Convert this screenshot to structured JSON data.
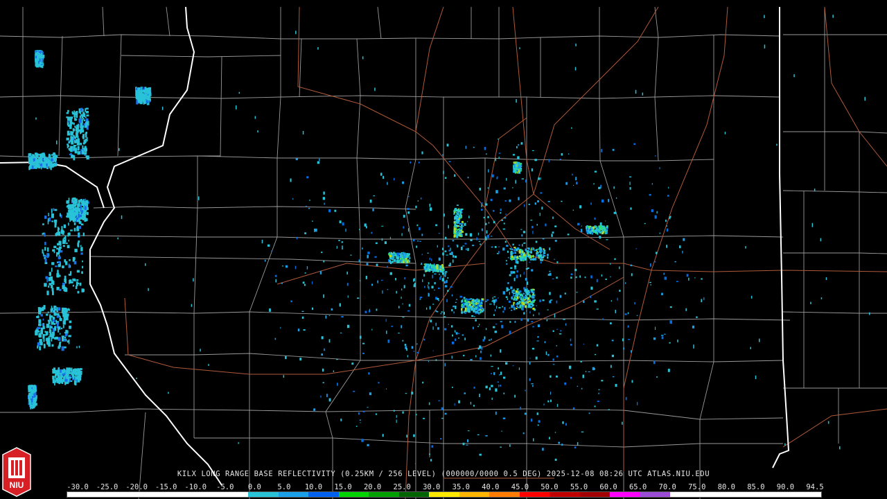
{
  "caption": "KILX LONG RANGE BASE REFLECTIVITY (0.25KM / 256 LEVEL) (000000/0000 0.5 DEG) 2025-12-08 08:26 UTC  ATLAS.NIU.EDU",
  "logo": {
    "text": "NIU",
    "color": "#d71f26"
  },
  "colors": {
    "background": "#000000",
    "county_lines": "#9a9a9a",
    "state_lines": "#ffffff",
    "roads": "#b05a3a"
  },
  "scale": {
    "labels": [
      "-30.0",
      "-25.0",
      "-20.0",
      "-15.0",
      "-10.0",
      "-5.0",
      "0.0",
      "5.0",
      "10.0",
      "15.0",
      "20.0",
      "25.0",
      "30.0",
      "35.0",
      "40.0",
      "45.0",
      "50.0",
      "55.0",
      "60.0",
      "65.0",
      "70.0",
      "75.0",
      "80.0",
      "85.0",
      "90.0",
      "94.5"
    ],
    "colors": [
      "#ffffff",
      "#ffffff",
      "#ffffff",
      "#ffffff",
      "#ffffff",
      "#ffffff",
      "#29c3d8",
      "#1aa0e8",
      "#0060f0",
      "#00d400",
      "#00a000",
      "#006400",
      "#ffe800",
      "#ffb400",
      "#ff7c00",
      "#ff0000",
      "#c00000",
      "#a00000",
      "#ff00ff",
      "#9a4cd6",
      "#ffffff",
      "#ffffff",
      "#ffffff",
      "#ffffff",
      "#ffffff"
    ]
  }
}
